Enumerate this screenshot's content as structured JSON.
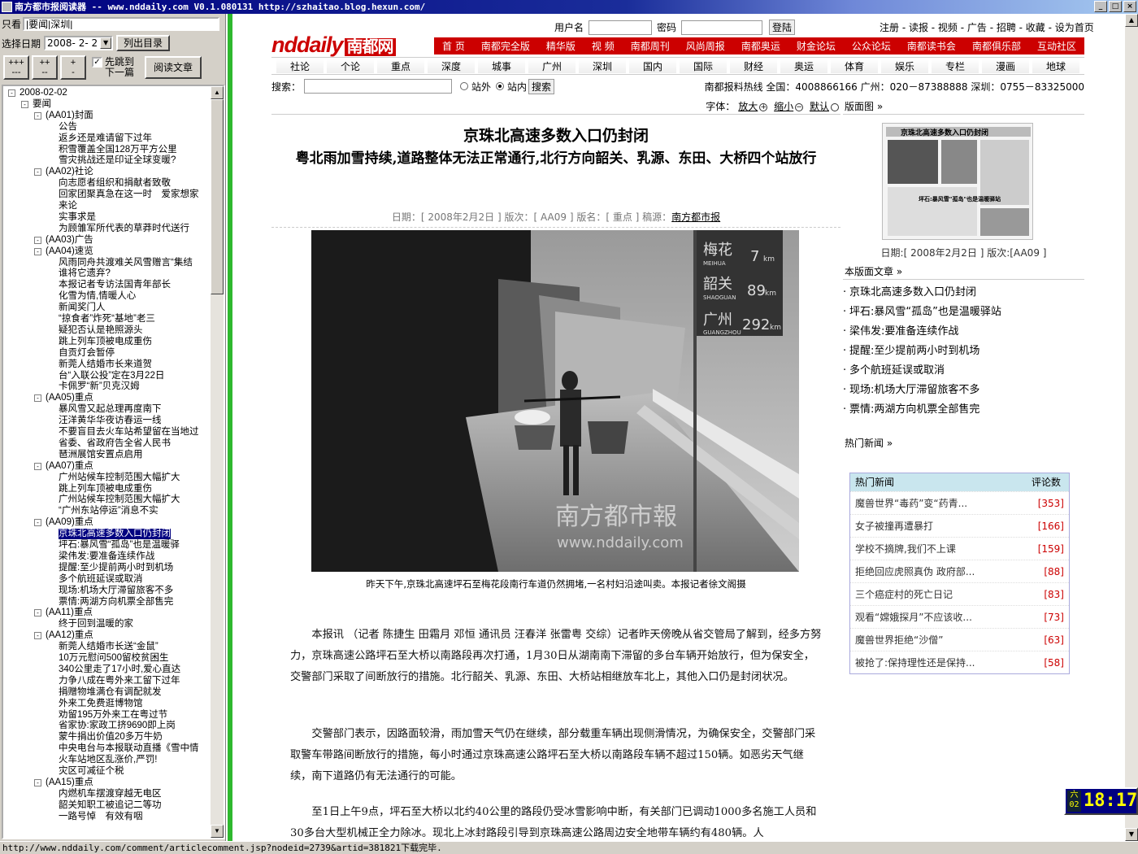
{
  "window": {
    "title": "南方都市报阅读器 -- www.nddaily.com  V0.1.080131 http://szhaitao.blog.hexun.com/"
  },
  "left": {
    "filter_label": "只看",
    "filter_value": "|要闻|深圳|",
    "date_label": "选择日期",
    "date_value": "2008- 2- 2",
    "list_button": "列出目录",
    "zoom_buttons": [
      {
        "top": "+++",
        "bottom": "---"
      },
      {
        "top": "++",
        "bottom": "--"
      },
      {
        "top": "+",
        "bottom": "-"
      }
    ],
    "jump_checkbox": "先跳到下一篇",
    "read_button": "阅读文章",
    "tree": [
      {
        "l": 0,
        "t": "2008-02-02",
        "pm": "-"
      },
      {
        "l": 1,
        "t": "要闻",
        "pm": "-"
      },
      {
        "l": 2,
        "t": "(AA01)封面",
        "pm": "-"
      },
      {
        "l": 3,
        "t": "公告"
      },
      {
        "l": 3,
        "t": "返乡还是难请留下过年"
      },
      {
        "l": 3,
        "t": "积雪覆盖全国128万平方公里"
      },
      {
        "l": 3,
        "t": "雪灾挑战还是印证全球变暖?"
      },
      {
        "l": 2,
        "t": "(AA02)社论",
        "pm": "-"
      },
      {
        "l": 3,
        "t": "向志愿者组织和捐献者致敬"
      },
      {
        "l": 3,
        "t": "回家团聚真急在这一时　爱家想家"
      },
      {
        "l": 3,
        "t": "来论"
      },
      {
        "l": 3,
        "t": "实事求是"
      },
      {
        "l": 3,
        "t": "为顾雏军所代表的草莽时代送行"
      },
      {
        "l": 2,
        "t": "(AA03)广告",
        "pm": "-"
      },
      {
        "l": 2,
        "t": "(AA04)速览",
        "pm": "-"
      },
      {
        "l": 3,
        "t": "风雨同舟共渡难关风雪赠言“集结"
      },
      {
        "l": 3,
        "t": "谁将它遗弃?"
      },
      {
        "l": 3,
        "t": "本报记者专访法国青年部长"
      },
      {
        "l": 3,
        "t": "化雪为情,情暖人心"
      },
      {
        "l": 3,
        "t": "新闻奖门人"
      },
      {
        "l": 3,
        "t": "“掠食者”炸死“基地”老三"
      },
      {
        "l": 3,
        "t": "疑犯否认是艳照源头"
      },
      {
        "l": 3,
        "t": "跳上列车顶被电成重伤"
      },
      {
        "l": 3,
        "t": "自贡灯会暂停"
      },
      {
        "l": 3,
        "t": "新莞人结婚市长来道贺"
      },
      {
        "l": 3,
        "t": "台“入联公投”定在3月22日"
      },
      {
        "l": 3,
        "t": "卡佩罗“新”贝克汉姆"
      },
      {
        "l": 2,
        "t": "(AA05)重点",
        "pm": "-"
      },
      {
        "l": 3,
        "t": "暴风雪又起总理再度南下"
      },
      {
        "l": 3,
        "t": "汪洋黄华华夜访春运一线"
      },
      {
        "l": 3,
        "t": "不要盲目去火车站希望留在当地过"
      },
      {
        "l": 3,
        "t": "省委、省政府告全省人民书"
      },
      {
        "l": 3,
        "t": "琶洲展馆安置点启用"
      },
      {
        "l": 2,
        "t": "(AA07)重点",
        "pm": "-"
      },
      {
        "l": 3,
        "t": "广州站候车控制范围大幅扩大"
      },
      {
        "l": 3,
        "t": "跳上列车顶被电成重伤"
      },
      {
        "l": 3,
        "t": "广州站候车控制范围大幅扩大"
      },
      {
        "l": 3,
        "t": "“广州东站停运”消息不实"
      },
      {
        "l": 2,
        "t": "(AA09)重点",
        "pm": "-"
      },
      {
        "l": 3,
        "t": "京珠北高速多数入口仍封闭",
        "sel": true
      },
      {
        "l": 3,
        "t": "坪石:暴风雪“孤岛”也是温暖驿"
      },
      {
        "l": 3,
        "t": "梁伟发:要准备连续作战"
      },
      {
        "l": 3,
        "t": "提醒:至少提前两小时到机场"
      },
      {
        "l": 3,
        "t": "多个航班延误或取消"
      },
      {
        "l": 3,
        "t": "现场:机场大厅滞留旅客不多"
      },
      {
        "l": 3,
        "t": "票情:两湖方向机票全部售完"
      },
      {
        "l": 2,
        "t": "(AA11)重点",
        "pm": "-"
      },
      {
        "l": 3,
        "t": "终于回到温暖的家"
      },
      {
        "l": 2,
        "t": "(AA12)重点",
        "pm": "-"
      },
      {
        "l": 3,
        "t": "新莞人结婚市长送“金鼠”"
      },
      {
        "l": 3,
        "t": "10万元慰问500留校贫困生"
      },
      {
        "l": 3,
        "t": "340公里走了17小时,爱心直达"
      },
      {
        "l": 3,
        "t": "力争八成在粤外来工留下过年"
      },
      {
        "l": 3,
        "t": "捐赠物堆满仓有调配就发"
      },
      {
        "l": 3,
        "t": "外来工免费逛博物馆"
      },
      {
        "l": 3,
        "t": "劝留195万外来工在粤过节"
      },
      {
        "l": 3,
        "t": "省家协:家政工挤9690即上岗"
      },
      {
        "l": 3,
        "t": "蒙牛捐出价值20多万牛奶"
      },
      {
        "l": 3,
        "t": "中央电台与本报联动直播《雪中情"
      },
      {
        "l": 3,
        "t": "火车站地区乱涨价,严罚!"
      },
      {
        "l": 3,
        "t": "灾区可减征个税"
      },
      {
        "l": 2,
        "t": "(AA15)重点",
        "pm": "-"
      },
      {
        "l": 3,
        "t": "内燃机车摆渡穿越无电区"
      },
      {
        "l": 3,
        "t": "韶关知职工被追记二等功"
      },
      {
        "l": 3,
        "t": "一路号悼　有效有咽"
      }
    ]
  },
  "site": {
    "logo": "nddaily",
    "logo_cn": "南都网",
    "logo_sub": ".com",
    "login": {
      "user_label": "用户名",
      "pass_label": "密码",
      "button": "登陆"
    },
    "top_links": "注册 - 读报 - 视频 - 广告 - 招聘 - 收藏 - 设为首页",
    "red_nav": [
      "首 页",
      "南都完全版",
      "精华版",
      "视 频",
      "南都周刊",
      "风尚周报",
      "南都奥运",
      "财金论坛",
      "公众论坛",
      "南都读书会",
      "南都俱乐部",
      "互动社区"
    ],
    "sub_nav": [
      "社论",
      "个论",
      "重点",
      "深度",
      "城事",
      "广州",
      "深圳",
      "国内",
      "国际",
      "财经",
      "奥运",
      "体育",
      "娱乐",
      "专栏",
      "漫画",
      "地球"
    ],
    "search": {
      "label": "搜索：",
      "opt1": "站外",
      "opt2": "站内",
      "button": "搜索",
      "hotline": "南都报料热线 全国：4008866166 广州：020－87388888 深圳：0755－83325000"
    },
    "font_ctrl": {
      "label": "字体：",
      "big": "放大",
      "small": "缩小",
      "default": "默认"
    }
  },
  "article": {
    "title": "京珠北高速多数入口仍封闭",
    "subtitle": "粤北雨加雪持续,道路整体无法正常通行,北行方向韶关、乳源、东田、大桥四个站放行",
    "meta": {
      "date_label": "日期：",
      "date": "[ 2008年2月2日 ]",
      "edition_label": " 版次：",
      "edition": "[ AA09 ]",
      "name_label": " 版名：",
      "name": "[ 重点 ]",
      "source_label": " 稿源：",
      "source": "南方都市报"
    },
    "photo_watermark_cn": "南方都市報",
    "photo_watermark_url": "www.nddaily.com",
    "sign1_name": "梅花",
    "sign1_pinyin": "MEIHUA",
    "sign1_km": "7",
    "sign2_name": "韶关",
    "sign2_pinyin": "SHAOGUAN",
    "sign2_km": "89",
    "sign3_name": "广州",
    "sign3_pinyin": "GUANGZHOU",
    "sign3_km": "292",
    "sign_unit": "km",
    "caption": "昨天下午,京珠北高速坪石至梅花段南行车道仍然拥堵,一名村妇沿途叫卖。本报记者徐文阁摄",
    "paragraphs": [
      "本报讯 （记者 陈捷生 田霜月 邓恒 通讯员 汪春洋 张雷粤 交综）记者昨天傍晚从省交管局了解到，经多方努力，京珠高速公路坪石至大桥以南路段再次打通，1月30日从湖南南下滞留的多台车辆开始放行，但为保安全，交警部门采取了间断放行的措施。北行韶关、乳源、东田、大桥站相继放车北上，其他入口仍是封闭状况。",
      "交警部门表示，因路面较滑，雨加雪天气仍在继续，部分载重车辆出现侧滑情况，为确保安全，交警部门采取警车带路间断放行的措施，每小时通过京珠高速公路坪石至大桥以南路段车辆不超过150辆。如恶劣天气继续，南下道路仍有无法通行的可能。",
      "至1日上午9点，坪石至大桥以北约40公里的路段仍受冰雪影响中断，有关部门已调动1000多名施工人员和30多台大型机械正全力除冰。现北上冰封路段引导到京珠高速公路周边安全地带车辆约有480辆。人"
    ]
  },
  "sidebar": {
    "page_head": "版面图",
    "thumb_headline": "京珠北高速多数入口仍封闭",
    "thumb_headline2": "坪石:暴风雪\"孤岛\"也是温暖驿站",
    "thumb_date": "日期:[ 2008年2月2日 ] 版次:[AA09 ]",
    "articles_head": "本版面文章",
    "articles": [
      "京珠北高速多数入口仍封闭",
      "坪石:暴风雪“孤岛”也是温暖驿站",
      "梁伟发:要准备连续作战",
      "提醒:至少提前两小时到机场",
      "多个航班延误或取消",
      "现场:机场大厅滞留旅客不多",
      "票情:两湖方向机票全部售完"
    ],
    "hot_head": "热门新闻",
    "hot_col1": "热门新闻",
    "hot_col2": "评论数",
    "hot": [
      {
        "t": "魔兽世界“毒药”变“药青...",
        "n": "[353]"
      },
      {
        "t": "女子被撞再遭暴打",
        "n": "[166]"
      },
      {
        "t": "学校不摘牌,我们不上课",
        "n": "[159]"
      },
      {
        "t": "拒绝回应虎照真伪 政府部...",
        "n": "[88]"
      },
      {
        "t": "三个癌症村的死亡日记",
        "n": "[83]"
      },
      {
        "t": "观看“嫦娥探月”不应该收...",
        "n": "[73]"
      },
      {
        "t": "魔兽世界拒绝“沙僧”",
        "n": "[63]"
      },
      {
        "t": "被抢了:保持理性还是保持...",
        "n": "[58]"
      }
    ]
  },
  "status": "http://www.nddaily.com/comment/articlecomment.jsp?nodeid=2739&artid=381821下载完毕.",
  "clock": {
    "day1": "六",
    "day2": "02",
    "time": "18:17"
  }
}
